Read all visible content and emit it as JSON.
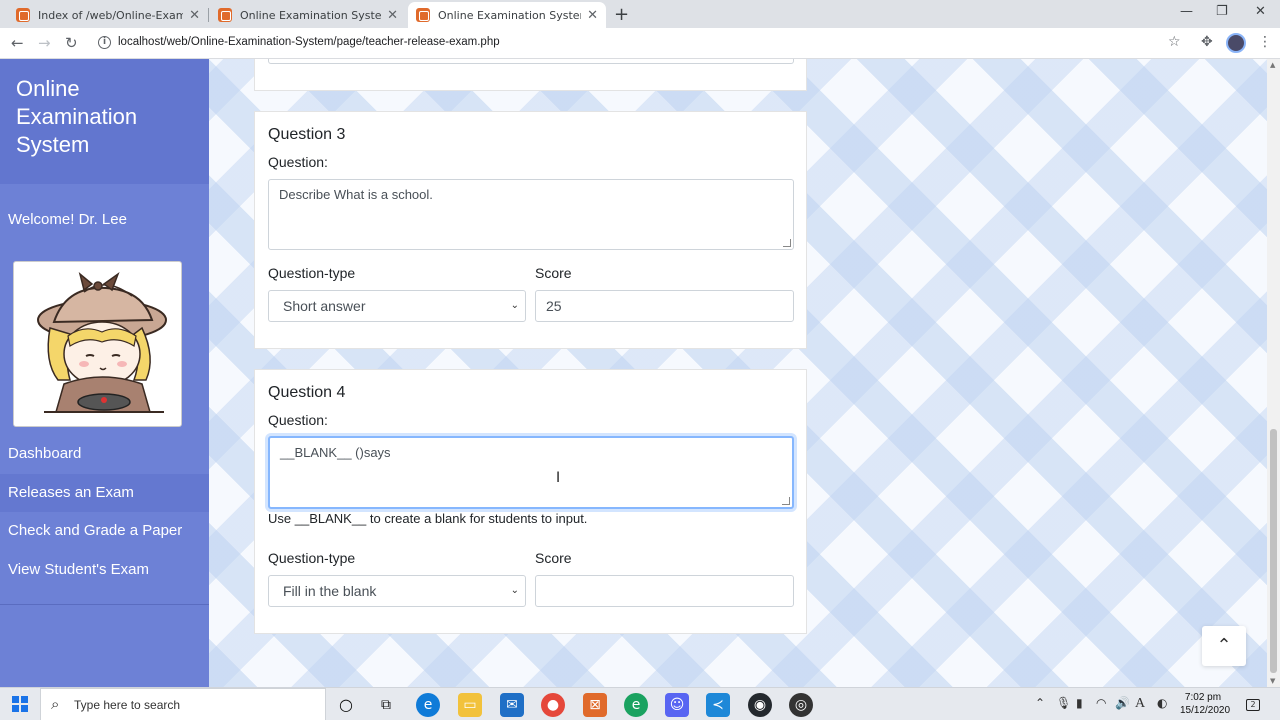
{
  "browser": {
    "tabs": [
      {
        "title": "Index of /web/Online-Examinatio"
      },
      {
        "title": "Online Examination System"
      },
      {
        "title": "Online Examination System"
      }
    ],
    "url": "localhost/web/Online-Examination-System/page/teacher-release-exam.php"
  },
  "sidebar": {
    "brand": "Online Examination System",
    "welcome": "Welcome! Dr. Lee",
    "nav": [
      {
        "label": "Dashboard"
      },
      {
        "label": "Releases an Exam"
      },
      {
        "label": "Check and Grade a Paper"
      },
      {
        "label": "View Student's Exam"
      }
    ]
  },
  "questions": [
    {
      "title": "Question 3",
      "question_label": "Question:",
      "question_text": "Describe What is a school.",
      "type_label": "Question-type",
      "type_value": "Short answer",
      "score_label": "Score",
      "score_value": "25"
    },
    {
      "title": "Question 4",
      "question_label": "Question:",
      "question_text": "__BLANK__ ()says",
      "hint": "Use __BLANK__ to create a blank for students to input.",
      "type_label": "Question-type",
      "type_value": "Fill in the blank",
      "score_label": "Score",
      "score_value": ""
    }
  ],
  "taskbar": {
    "search_placeholder": "Type here to search",
    "time": "7:02 pm",
    "date": "15/12/2020",
    "notification_count": "2"
  }
}
